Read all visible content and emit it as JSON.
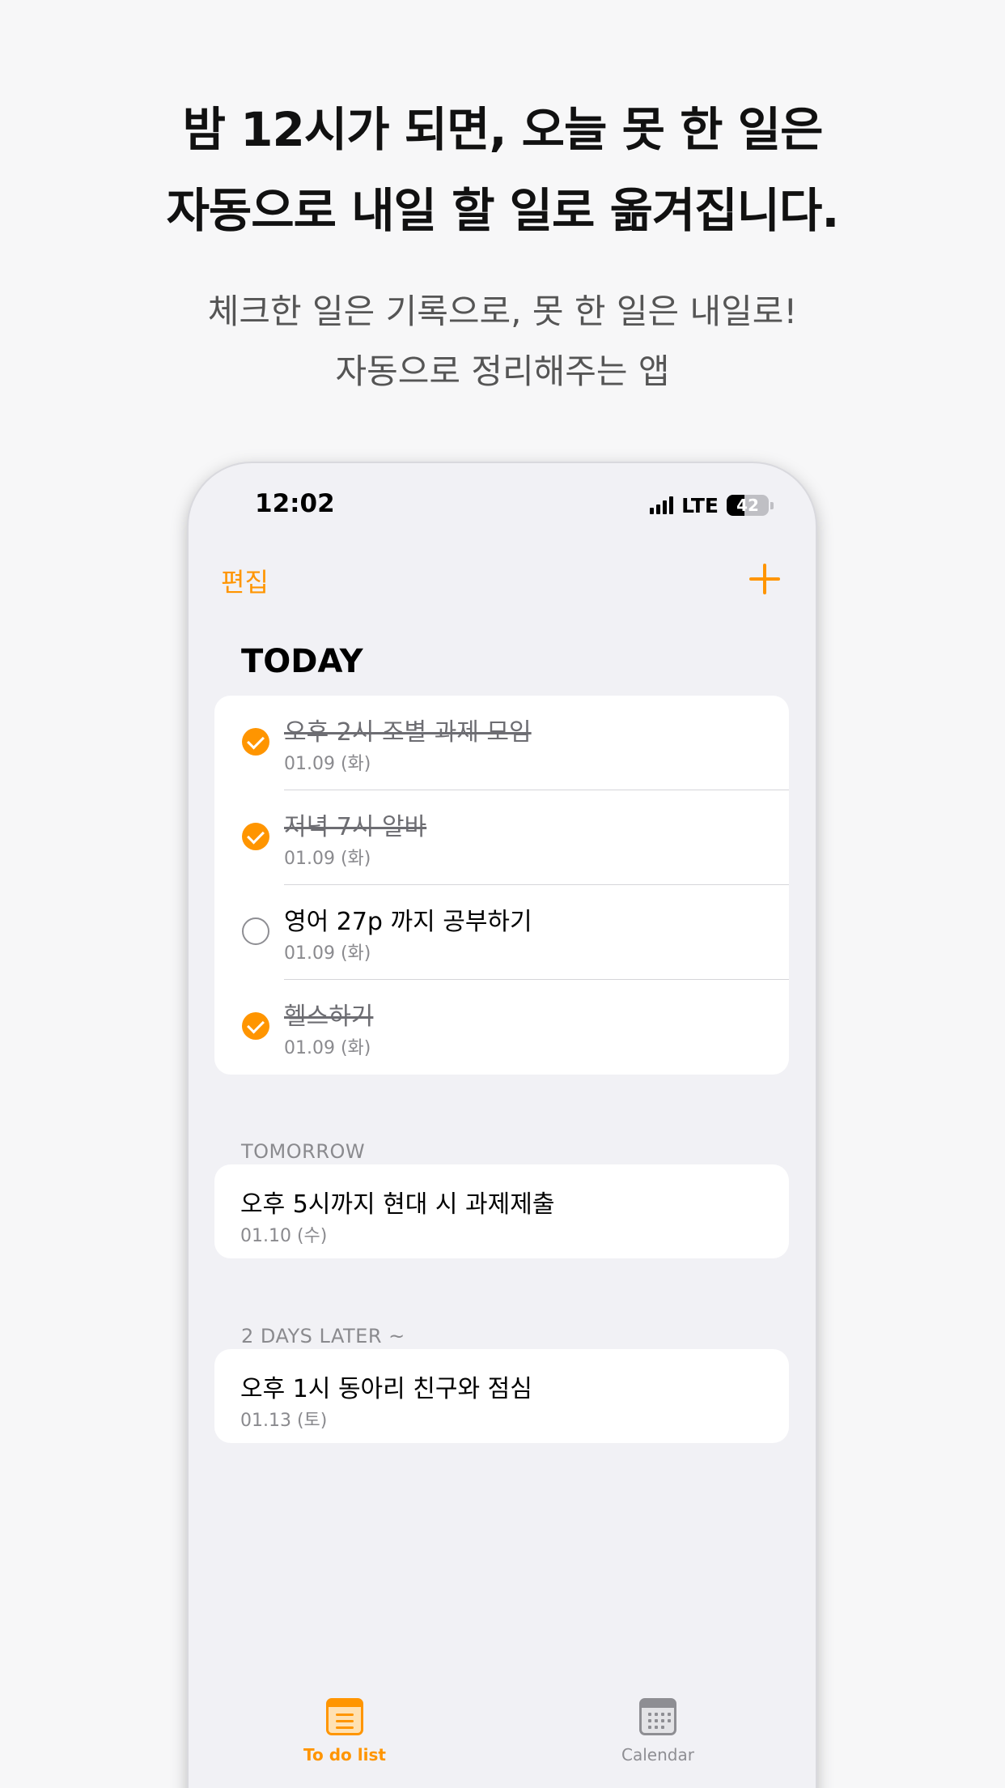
{
  "marketing": {
    "headline_line1": "밤 12시가 되면, 오늘 못 한 일은",
    "headline_line2": "자동으로 내일 할 일로 옮겨집니다.",
    "sub_line1": "체크한 일은 기록으로, 못 한 일은 내일로!",
    "sub_line2": "자동으로 정리해주는 앱"
  },
  "status_bar": {
    "time": "12:02",
    "network": "LTE",
    "battery_level": "42",
    "battery_fraction": 0.42
  },
  "nav": {
    "edit_label": "편집",
    "add_icon": "plus-icon"
  },
  "sections": {
    "today": {
      "title": "TODAY",
      "items": [
        {
          "title": "오후 2시 조별 과제 모임",
          "date": "01.09 (화)",
          "done": true
        },
        {
          "title": "저녁 7시 알바",
          "date": "01.09 (화)",
          "done": true
        },
        {
          "title": "영어 27p 까지 공부하기",
          "date": "01.09 (화)",
          "done": false
        },
        {
          "title": "헬스하기",
          "date": "01.09 (화)",
          "done": true
        }
      ]
    },
    "tomorrow": {
      "title": "TOMORROW",
      "items": [
        {
          "title": "오후 5시까지 현대 시 과제제출",
          "date": "01.10 (수)"
        }
      ]
    },
    "later": {
      "title": "2 DAYS LATER ~",
      "items": [
        {
          "title": "오후 1시 동아리 친구와 점심",
          "date": "01.13 (토)"
        }
      ]
    }
  },
  "tabs": [
    {
      "label": "To do list",
      "icon": "list-icon",
      "active": true
    },
    {
      "label": "Calendar",
      "icon": "calendar-icon",
      "active": false
    }
  ],
  "colors": {
    "accent": "#ff9500",
    "background": "#f1f1f5",
    "secondary_text": "#8a8a8e"
  }
}
